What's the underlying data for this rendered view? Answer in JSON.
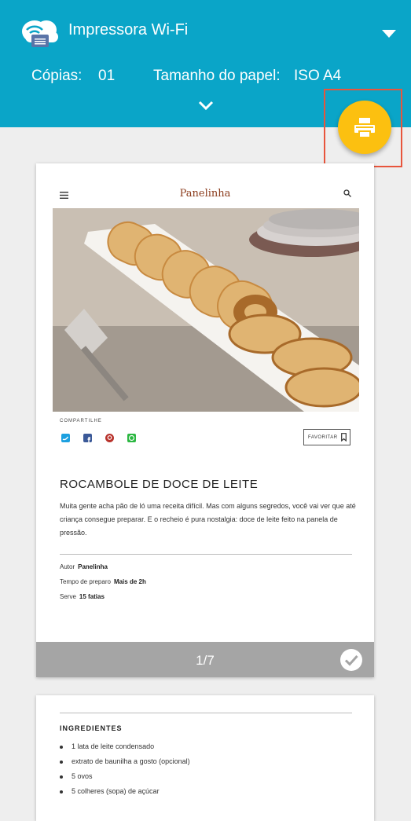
{
  "header": {
    "title": "Impressora Wi-Fi",
    "copies_label": "Cópias:",
    "copies_value": "01",
    "paper_label": "Tamanho do papel:",
    "paper_value": "ISO A4"
  },
  "colors": {
    "header": "#0aa5c8",
    "fab": "#fcc010",
    "highlight": "#e8553c",
    "footer": "#a5a5a5"
  },
  "preview": {
    "brand": "Panelinha",
    "share_label": "COMPARTILHE",
    "favorite_label": "FAVORITAR",
    "recipe_title": "ROCAMBOLE DE DOCE DE LEITE",
    "description": "Muita gente acha pão de ló uma receita difícil. Mas com alguns segredos, você vai ver que até criança consegue preparar. E o recheio é pura nostalgia: doce de leite feito na panela de pressão.",
    "meta": [
      {
        "label": "Autor",
        "value": "Panelinha"
      },
      {
        "label": "Tempo de preparo",
        "value": "Mais de 2h"
      },
      {
        "label": "Serve",
        "value": "15 fatias"
      }
    ],
    "page_indicator": "1/7"
  },
  "page2": {
    "ingredients_title": "INGREDIENTES",
    "ingredients": [
      "1 lata de leite condensado",
      "extrato de baunilha a gosto (opcional)",
      "5 ovos",
      "5 colheres (sopa) de açúcar"
    ]
  }
}
